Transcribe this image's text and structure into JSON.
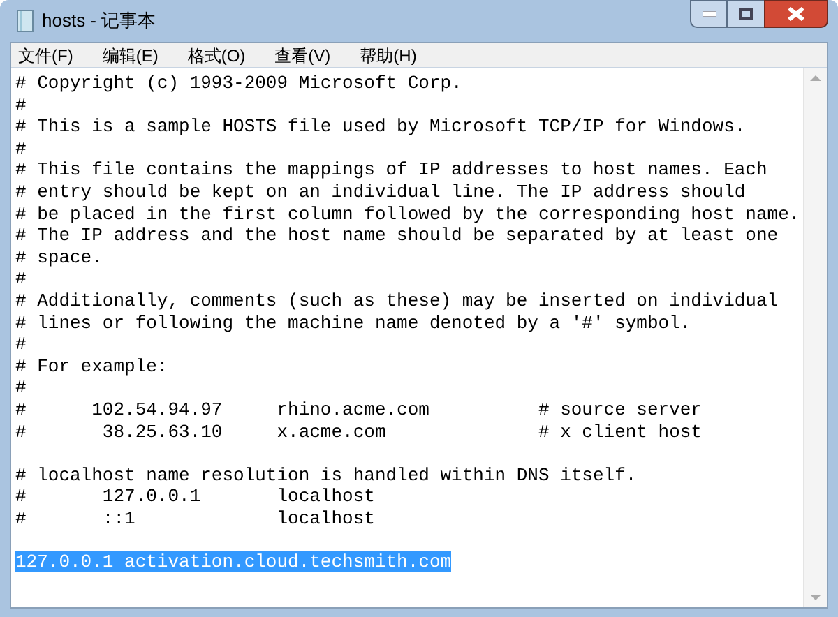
{
  "window": {
    "title": "hosts - 记事本"
  },
  "menu": [
    {
      "label": "文件(F)"
    },
    {
      "label": "编辑(E)"
    },
    {
      "label": "格式(O)"
    },
    {
      "label": "查看(V)"
    },
    {
      "label": "帮助(H)"
    }
  ],
  "lines": [
    {
      "kind": "text",
      "text": "# Copyright (c) 1993-2009 Microsoft Corp.",
      "selected": false
    },
    {
      "kind": "text",
      "text": "#",
      "selected": false
    },
    {
      "kind": "text",
      "text": "# This is a sample HOSTS file used by Microsoft TCP/IP for Windows.",
      "selected": false
    },
    {
      "kind": "text",
      "text": "#",
      "selected": false
    },
    {
      "kind": "text",
      "text": "# This file contains the mappings of IP addresses to host names. Each",
      "selected": false
    },
    {
      "kind": "text",
      "text": "# entry should be kept on an individual line. The IP address should",
      "selected": false
    },
    {
      "kind": "text",
      "text": "# be placed in the first column followed by the corresponding host name.",
      "selected": false
    },
    {
      "kind": "text",
      "text": "# The IP address and the host name should be separated by at least one",
      "selected": false
    },
    {
      "kind": "text",
      "text": "# space.",
      "selected": false
    },
    {
      "kind": "text",
      "text": "#",
      "selected": false
    },
    {
      "kind": "text",
      "text": "# Additionally, comments (such as these) may be inserted on individual",
      "selected": false
    },
    {
      "kind": "text",
      "text": "# lines or following the machine name denoted by a '#' symbol.",
      "selected": false
    },
    {
      "kind": "text",
      "text": "#",
      "selected": false
    },
    {
      "kind": "text",
      "text": "# For example:",
      "selected": false
    },
    {
      "kind": "text",
      "text": "#",
      "selected": false
    },
    {
      "kind": "text",
      "text": "#      102.54.94.97     rhino.acme.com          # source server",
      "selected": false
    },
    {
      "kind": "text",
      "text": "#       38.25.63.10     x.acme.com              # x client host",
      "selected": false
    },
    {
      "kind": "blank"
    },
    {
      "kind": "text",
      "text": "# localhost name resolution is handled within DNS itself.",
      "selected": false
    },
    {
      "kind": "text",
      "text": "#       127.0.0.1       localhost",
      "selected": false
    },
    {
      "kind": "text",
      "text": "#       ::1             localhost",
      "selected": false
    },
    {
      "kind": "blank"
    },
    {
      "kind": "text",
      "text": "127.0.0.1 activation.cloud.techsmith.com",
      "selected": true
    }
  ]
}
